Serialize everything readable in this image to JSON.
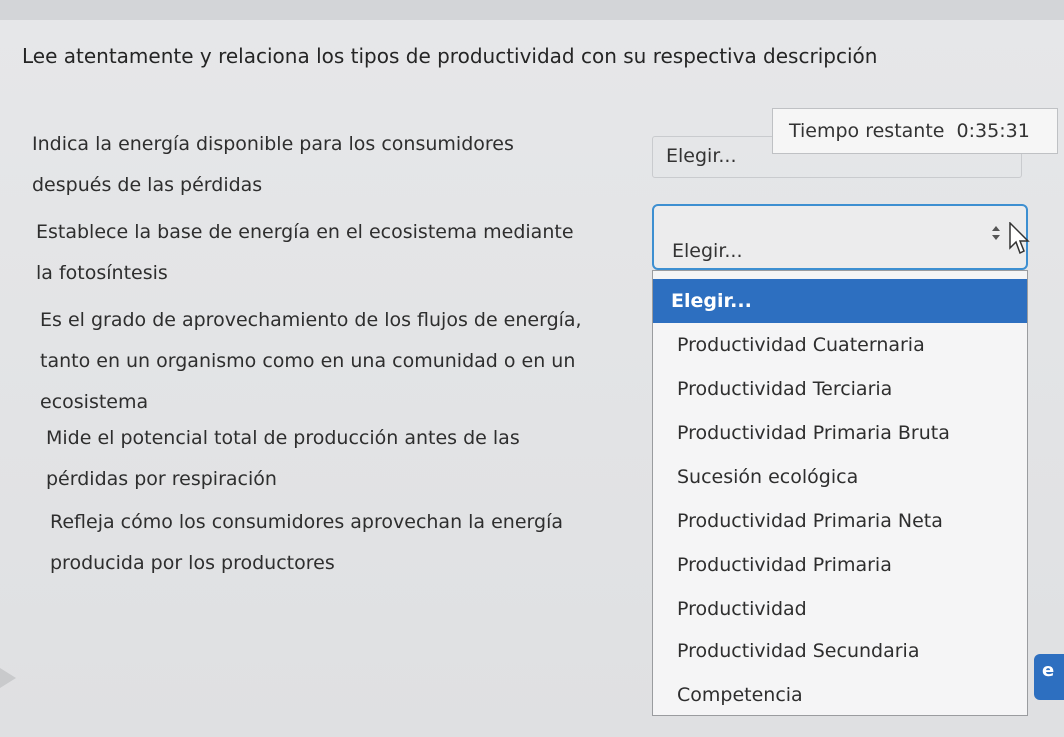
{
  "instruction": "Lee atentamente y relaciona los tipos de productividad con su respectiva descripción",
  "timer": {
    "label": "Tiempo restante",
    "value": "0:35:31"
  },
  "questions": [
    {
      "line1": "Indica la energía disponible para los consumidores",
      "line2": "después de las pérdidas"
    },
    {
      "line1": "Establece la base de energía en el ecosistema mediante",
      "line2": "la fotosíntesis"
    },
    {
      "line1": "Es el grado de aprovechamiento de los flujos de energía,",
      "line2": "tanto en un organismo como en una comunidad o en un",
      "line3": "ecosistema"
    },
    {
      "line1": "Mide el potencial total de producción antes de las",
      "line2": "pérdidas por respiración"
    },
    {
      "line1": "Refleja cómo los consumidores aprovechan la energía",
      "line2": "producida por los productores"
    }
  ],
  "selects": {
    "closed_value": "Elegir...",
    "open_value": "Elegir..."
  },
  "dropdown": {
    "options": [
      "Elegir...",
      "Productividad Cuaternaria",
      "Productividad Terciaria",
      "Productividad Primaria Bruta",
      "Sucesión ecológica",
      "Productividad Primaria Neta",
      "Productividad Primaria",
      "Productividad",
      "Productividad Secundaria",
      "Competencia"
    ],
    "selected_index": 0
  },
  "badge": "e",
  "colors": {
    "accent": "#2d6fc0",
    "focus_border": "#3d8fd1"
  }
}
